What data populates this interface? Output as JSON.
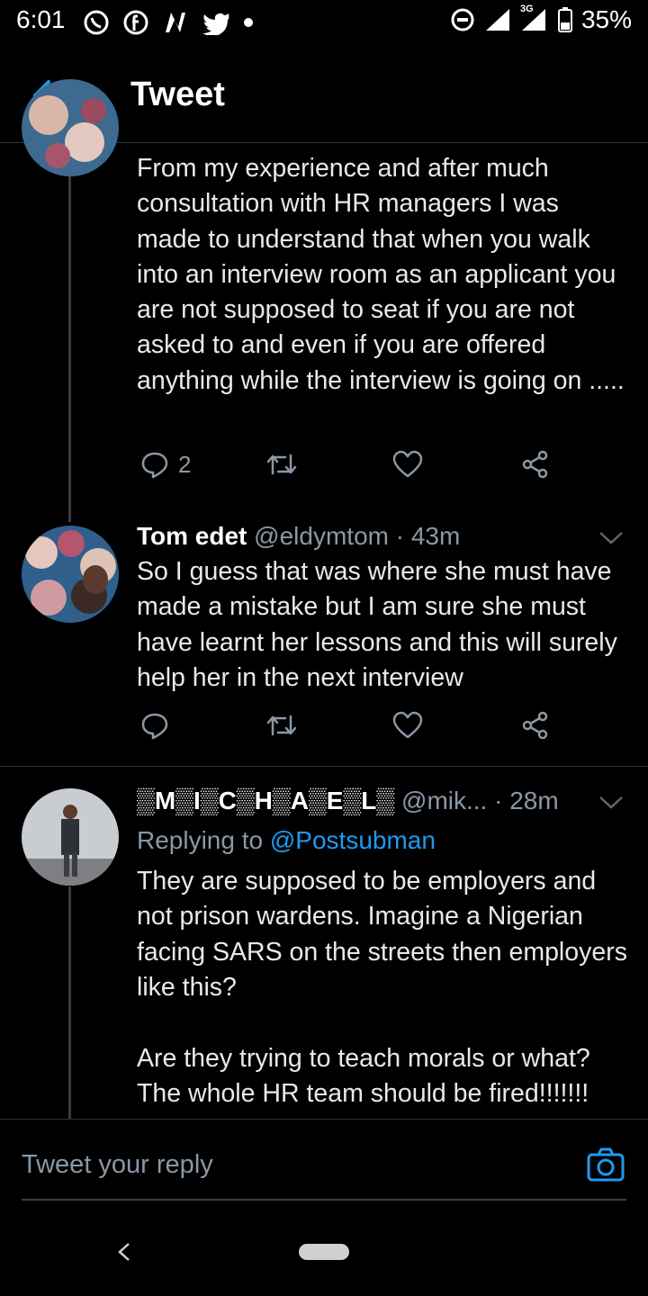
{
  "status_bar": {
    "time": "6:01",
    "network": "3G",
    "battery": "35%"
  },
  "header": {
    "title": "Tweet"
  },
  "tweets": [
    {
      "text": "From my experience and after much consultation with HR managers I was made to understand that when you walk into an interview room as an applicant you are not supposed to seat if you are not asked to and even if you are offered anything while the interview is going on .....",
      "reply_count": "2"
    },
    {
      "name": "Tom edet",
      "handle": "@eldymtom",
      "time": "· 43m",
      "text": "So I guess that was where she must have made a mistake but I am sure she must have learnt her lessons and this will surely help her in the next interview"
    },
    {
      "name": "▒M▒I▒C▒H▒A▒E▒L▒",
      "handle": "@mik...",
      "time": "· 28m",
      "replying_prefix": "Replying to",
      "replying_to": "@Postsubman",
      "text_p1": "They are supposed to be employers and not prison wardens. Imagine a Nigerian facing SARS on the streets then employers like this?",
      "text_p2": "Are they trying to teach morals or what? The whole HR team should be fired!!!!!!!"
    }
  ],
  "reply_box": {
    "placeholder": "Tweet your reply"
  },
  "colors": {
    "accent": "#1d9bf0",
    "muted": "#8b98a5",
    "background": "#000000"
  }
}
